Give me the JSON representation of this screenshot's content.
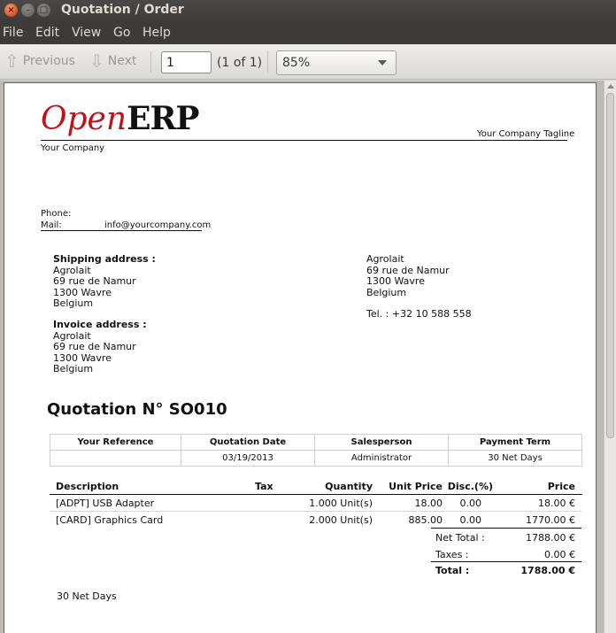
{
  "window": {
    "title": "Quotation / Order"
  },
  "menu": [
    "File",
    "Edit",
    "View",
    "Go",
    "Help"
  ],
  "toolbar": {
    "previous": "Previous",
    "next": "Next",
    "page_value": "1",
    "page_of": "(1 of 1)",
    "zoom": "85%"
  },
  "doc": {
    "logo_open": "Open",
    "logo_erp": "ERP",
    "tagline": "Your Company Tagline",
    "company": "Your Company",
    "phone_label": "Phone:",
    "mail_label": "Mail:",
    "mail_value": "info@yourcompany.com",
    "shipping_title": "Shipping address :",
    "shipping": [
      "Agrolait",
      "69 rue de Namur",
      "1300 Wavre",
      "Belgium"
    ],
    "invoice_title": "Invoice address :",
    "invoice": [
      "Agrolait",
      "69 rue de Namur",
      "1300 Wavre",
      "Belgium"
    ],
    "partner": [
      "Agrolait",
      "69 rue de Namur",
      "1300 Wavre",
      "Belgium"
    ],
    "partner_tel": "Tel. : +32 10 588 558",
    "quotation_title": "Quotation N° SO010",
    "info_headers": [
      "Your Reference",
      "Quotation Date",
      "Salesperson",
      "Payment Term"
    ],
    "info_values": [
      "",
      "03/19/2013",
      "Administrator",
      "30 Net Days"
    ],
    "line_headers": {
      "description": "Description",
      "tax": "Tax",
      "quantity": "Quantity",
      "unit_price": "Unit Price",
      "disc": "Disc.(%)",
      "price": "Price"
    },
    "lines": [
      {
        "description": "[ADPT] USB Adapter",
        "tax": "",
        "quantity": "1.000 Unit(s)",
        "unit_price": "18.00",
        "disc": "0.00",
        "price": "18.00 €"
      },
      {
        "description": "[CARD] Graphics Card",
        "tax": "",
        "quantity": "2.000 Unit(s)",
        "unit_price": "885.00",
        "disc": "0.00",
        "price": "1770.00 €"
      }
    ],
    "net_total_label": "Net Total :",
    "net_total": "1788.00 €",
    "taxes_label": "Taxes :",
    "taxes": "0.00 €",
    "total_label": "Total :",
    "total": "1788.00 €",
    "payment_note": "30 Net Days"
  }
}
